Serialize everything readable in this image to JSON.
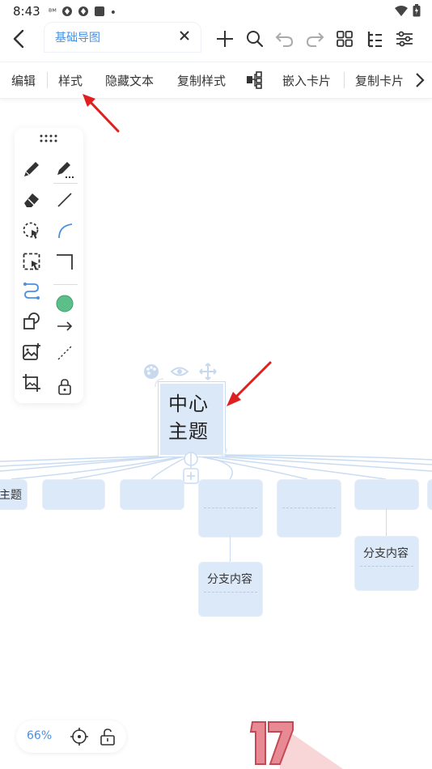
{
  "status_bar": {
    "time": "8:43"
  },
  "tab": {
    "title": "基础导图"
  },
  "toolbar": {
    "items": [
      "编辑",
      "样式",
      "隐藏文本",
      "复制样式",
      "嵌入卡片",
      "复制卡片"
    ]
  },
  "map": {
    "center_line1": "中心",
    "center_line2": "主题",
    "left_partial": "主题",
    "branch_label_1": "分支内容",
    "branch_label_2": "分支内容"
  },
  "bottom": {
    "zoom": "66%"
  },
  "colors": {
    "accent": "#4a90e2",
    "node_fill": "#dbe8f8",
    "annotation": "#e02020"
  }
}
